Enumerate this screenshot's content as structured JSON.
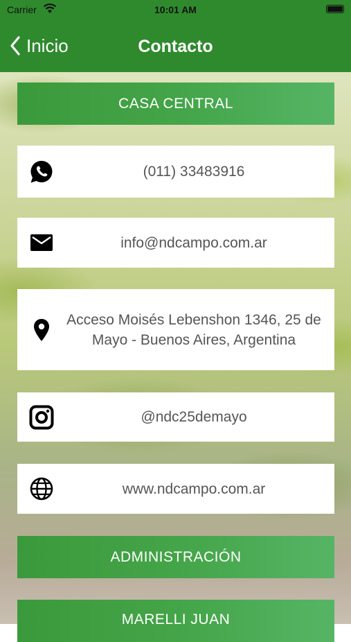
{
  "status_bar": {
    "carrier": "Carrier",
    "time": "10:01 AM"
  },
  "nav": {
    "back_label": "Inicio",
    "title": "Contacto"
  },
  "sections": {
    "casa_central": "CASA CENTRAL",
    "administracion": "ADMINISTRACIÓN",
    "next": "MARELLI JUAN"
  },
  "contacts": {
    "phone": {
      "icon": "whatsapp-icon",
      "text": "(011) 33483916"
    },
    "email": {
      "icon": "mail-icon",
      "text": "info@ndcampo.com.ar"
    },
    "address": {
      "icon": "location-pin-icon",
      "text": "Acceso Moisés Lebenshon 1346, 25 de Mayo - Buenos Aires, Argentina"
    },
    "instagram": {
      "icon": "instagram-icon",
      "text": "@ndc25demayo"
    },
    "web": {
      "icon": "globe-icon",
      "text": "www.ndcampo.com.ar"
    }
  },
  "colors": {
    "nav_green": "#2f8a2d",
    "button_green": "#44a448",
    "text_gray": "#555555"
  }
}
